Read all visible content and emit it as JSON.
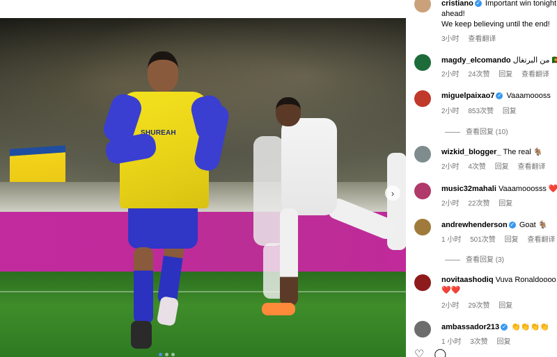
{
  "post": {
    "author": "cristiano",
    "caption_line1": "Important win tonight",
    "caption_line2": "ahead!",
    "caption_line3": "We keep believing until the end!",
    "time": "3小时",
    "translate": "查看翻译",
    "jersey_sponsor": "SHUREAH"
  },
  "comments": [
    {
      "user": "magdy_elcomando",
      "verified": false,
      "text": "من البرتغال 🇵🇹",
      "time": "2小时",
      "likes": "24次赞",
      "reply": "回复",
      "translate": "查看翻译",
      "more": "···",
      "avatar_color": "#1d6b38"
    },
    {
      "user": "miguelpaixao7",
      "verified": true,
      "text": "Vaaamoooss",
      "time": "2小时",
      "likes": "853次赞",
      "reply": "回复",
      "avatar_color": "#c0392b"
    },
    {
      "user": "wizkid_blogger_",
      "verified": false,
      "text": "The real 🐐",
      "time": "2小时",
      "likes": "4次赞",
      "reply": "回复",
      "translate": "查看翻译",
      "avatar_color": "#7f8c8d"
    },
    {
      "user": "music32mahali",
      "verified": false,
      "text": "Vaaamooosss ❤️❤️",
      "time": "2小时",
      "likes": "22次赞",
      "reply": "回复",
      "avatar_color": "#b03a6a"
    },
    {
      "user": "andrewhenderson",
      "verified": true,
      "text": "Goat 🐐",
      "time": "1 小时",
      "likes": "501次赞",
      "reply": "回复",
      "translate": "查看翻译",
      "avatar_color": "#a07a3a"
    },
    {
      "user": "novitaashodiq",
      "verified": false,
      "text": "Vuva Ronaldoooo",
      "text2": "❤️❤️",
      "time": "2小时",
      "likes": "29次赞",
      "reply": "回复",
      "avatar_color": "#8e1b1b"
    },
    {
      "user": "ambassador213",
      "verified": true,
      "text": "👏👏👏👏",
      "time": "1 小时",
      "likes": "3次赞",
      "reply": "回复",
      "avatar_color": "#6d6d6d"
    }
  ],
  "replies": {
    "miguelpaixao7": "查看回复 (10)",
    "andrewhenderson": "查看回复 (3)"
  },
  "icons": {
    "heart": "♡",
    "comment": "◯",
    "next": "›"
  }
}
